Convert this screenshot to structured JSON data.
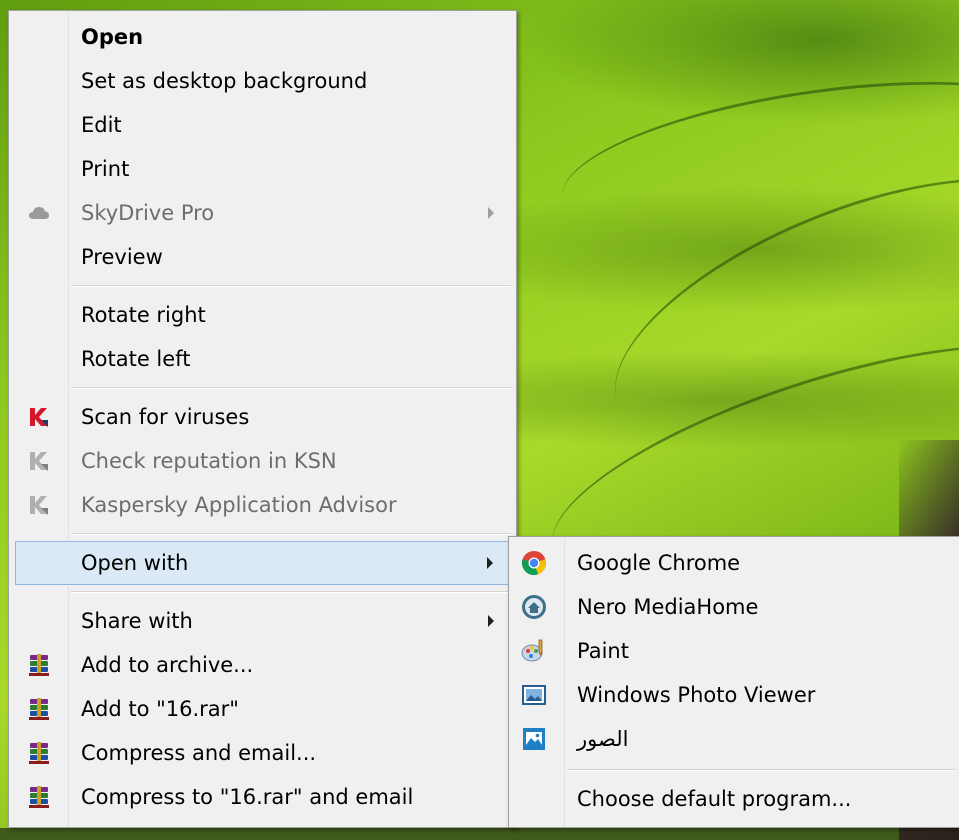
{
  "context_menu": {
    "items": [
      {
        "label": "Open"
      },
      {
        "label": "Set as desktop background"
      },
      {
        "label": "Edit"
      },
      {
        "label": "Print"
      },
      {
        "label": "SkyDrive Pro",
        "icon": "cloud-icon"
      },
      {
        "label": "Preview"
      },
      {
        "label": "Rotate right"
      },
      {
        "label": "Rotate left"
      },
      {
        "label": "Scan for viruses",
        "icon": "kaspersky-icon"
      },
      {
        "label": "Check reputation in KSN",
        "icon": "kaspersky-icon"
      },
      {
        "label": "Kaspersky Application Advisor",
        "icon": "kaspersky-icon"
      },
      {
        "label": "Open with"
      },
      {
        "label": "Share with"
      },
      {
        "label": "Add to archive...",
        "icon": "winrar-icon"
      },
      {
        "label": "Add to \"16.rar\"",
        "icon": "winrar-icon"
      },
      {
        "label": "Compress and email...",
        "icon": "winrar-icon"
      },
      {
        "label": "Compress to \"16.rar\" and email",
        "icon": "winrar-icon"
      }
    ]
  },
  "open_with_submenu": {
    "items": [
      {
        "label": "Google Chrome",
        "icon": "chrome-icon"
      },
      {
        "label": "Nero MediaHome",
        "icon": "nero-mediahome-icon"
      },
      {
        "label": "Paint",
        "icon": "paint-icon"
      },
      {
        "label": "Windows Photo Viewer",
        "icon": "photo-viewer-icon"
      },
      {
        "label": "الصور",
        "icon": "photos-app-icon"
      },
      {
        "label": "Choose default program..."
      }
    ]
  },
  "colors": {
    "menu_background": "#f0f0f0",
    "highlight_background": "#dbe8f6",
    "highlight_border": "#8fb5e0",
    "disabled_text": "#6d6d6d",
    "kaspersky_red": "#d4182b"
  }
}
